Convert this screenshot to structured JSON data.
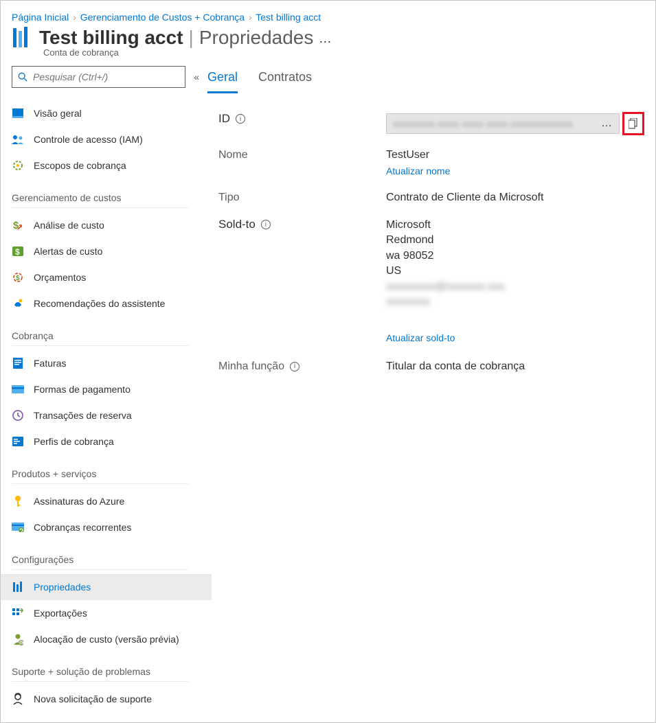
{
  "breadcrumb": {
    "home": "Página Inicial",
    "cm": "Gerenciamento de Custos + Cobrança",
    "acct": "Test billing acct"
  },
  "header": {
    "title": "Test billing acct",
    "section": "Propriedades",
    "type": "Conta de cobrança"
  },
  "search": {
    "placeholder": "Pesquisar (Ctrl+/)"
  },
  "nav": {
    "top": {
      "overview": "Visão geral",
      "iam": "Controle de acesso (IAM)",
      "scopes": "Escopos de cobrança"
    },
    "groups": {
      "costmgmt": "Gerenciamento de custos",
      "billing": "Cobrança",
      "products": "Produtos +  serviços",
      "settings": "Configurações",
      "support": "Suporte +  solução de problemas"
    },
    "costmgmt": {
      "analysis": "Análise de custo",
      "alerts": "Alertas de custo",
      "budgets": "Orçamentos",
      "advisor": "Recomendações do assistente"
    },
    "billing": {
      "invoices": "Faturas",
      "payment": "Formas de pagamento",
      "reservations": "Transações de reserva",
      "profiles": "Perfis de cobrança"
    },
    "products": {
      "subscriptions": "Assinaturas do Azure",
      "recurring": "Cobranças recorrentes"
    },
    "settings": {
      "properties": "Propriedades",
      "exports": "Exportações",
      "allocation": "Alocação de custo (versão prévia)"
    },
    "support": {
      "newrequest": "Nova solicitação de suporte"
    }
  },
  "tabs": {
    "general": "Geral",
    "contracts": "Contratos"
  },
  "fields": {
    "id_label": "ID",
    "id_value": "xxxxxxxx-xxxx-xxxx-xxxx-xxxxxxxxxxxx",
    "name_label": "Nome",
    "name_value": "TestUser",
    "update_name": "Atualizar nome",
    "type_label": "Tipo",
    "type_value": "Contrato de Cliente da Microsoft",
    "soldto_label": "Sold-to",
    "soldto": {
      "company": "Microsoft",
      "city": "Redmond",
      "state_zip": "wa 98052",
      "country": "US"
    },
    "update_soldto": "Atualizar sold-to",
    "role_label": "Minha função",
    "role_value": "Titular da conta de cobrança"
  }
}
